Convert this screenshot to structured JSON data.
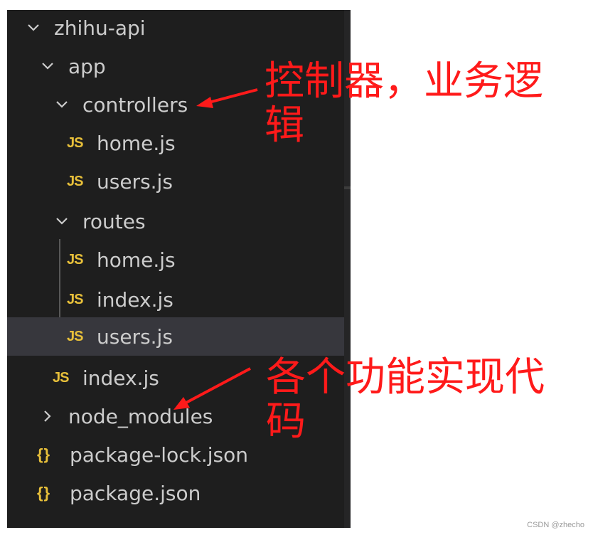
{
  "explorer": {
    "root": {
      "label": "zhihu-api"
    },
    "app": {
      "label": "app"
    },
    "controllers": {
      "label": "controllers"
    },
    "controllers_home": {
      "label": "home.js",
      "icon": "js-icon"
    },
    "controllers_users": {
      "label": "users.js",
      "icon": "js-icon"
    },
    "routes": {
      "label": "routes"
    },
    "routes_home": {
      "label": "home.js",
      "icon": "js-icon"
    },
    "routes_index": {
      "label": "index.js",
      "icon": "js-icon"
    },
    "routes_users": {
      "label": "users.js",
      "icon": "js-icon",
      "selected": true
    },
    "app_index": {
      "label": "index.js",
      "icon": "js-icon"
    },
    "node_modules": {
      "label": "node_modules"
    },
    "package_lock": {
      "label": "package-lock.json",
      "icon": "json-icon"
    },
    "package": {
      "label": "package.json",
      "icon": "json-icon"
    },
    "js_badge": "JS",
    "json_badge": "{}"
  },
  "annotations": {
    "controllers_note_line1": "控制器，业务逻",
    "controllers_note_line2": "辑",
    "app_index_note_line1": "各个功能实现代",
    "app_index_note_line2": "码",
    "color": "#ff1a1a"
  },
  "watermark": "CSDN @zhecho"
}
